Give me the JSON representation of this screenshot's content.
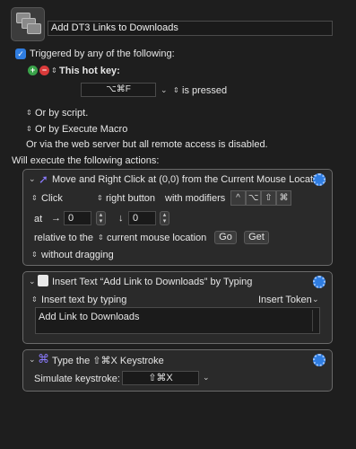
{
  "macro": {
    "name": "Add DT3 Links to Downloads"
  },
  "trigger": {
    "triggered_by": "Triggered by any of the following:",
    "hotkey_label": "This hot key:",
    "hotkey_value": "⌥⌘F",
    "is_pressed": "is pressed",
    "or_by_script": "Or by script.",
    "or_by_execute": "Or by Execute Macro",
    "web_server_note": "Or via the web server but all remote access is disabled."
  },
  "actions_heading": "Will execute the following actions:",
  "action1": {
    "title": "Move and Right Click at (0,0) from the Current Mouse Location",
    "click_label": "Click",
    "button_label": "right button",
    "with_modifiers": "with modifiers",
    "modifiers": [
      "^",
      "⌥",
      "⇧",
      "⌘"
    ],
    "at_label": "at",
    "x_arrow": "→",
    "x_value": "0",
    "y_arrow": "↓",
    "y_value": "0",
    "relative_label": "relative to the",
    "relative_value": "current mouse location",
    "go_label": "Go",
    "get_label": "Get",
    "drag_label": "without dragging"
  },
  "action2": {
    "title": "Insert Text “Add Link to Downloads” by Typing",
    "mode_label": "Insert text by typing",
    "token_label": "Insert Token",
    "text_value": "Add Link to Downloads"
  },
  "action3": {
    "title": "Type the ⇧⌘X Keystroke",
    "simulate_label": "Simulate keystroke:",
    "keystroke_value": "⇧⌘X"
  },
  "colors": {
    "accent": "#2f7de1",
    "add": "#3aa34a",
    "remove": "#d93a3a"
  }
}
